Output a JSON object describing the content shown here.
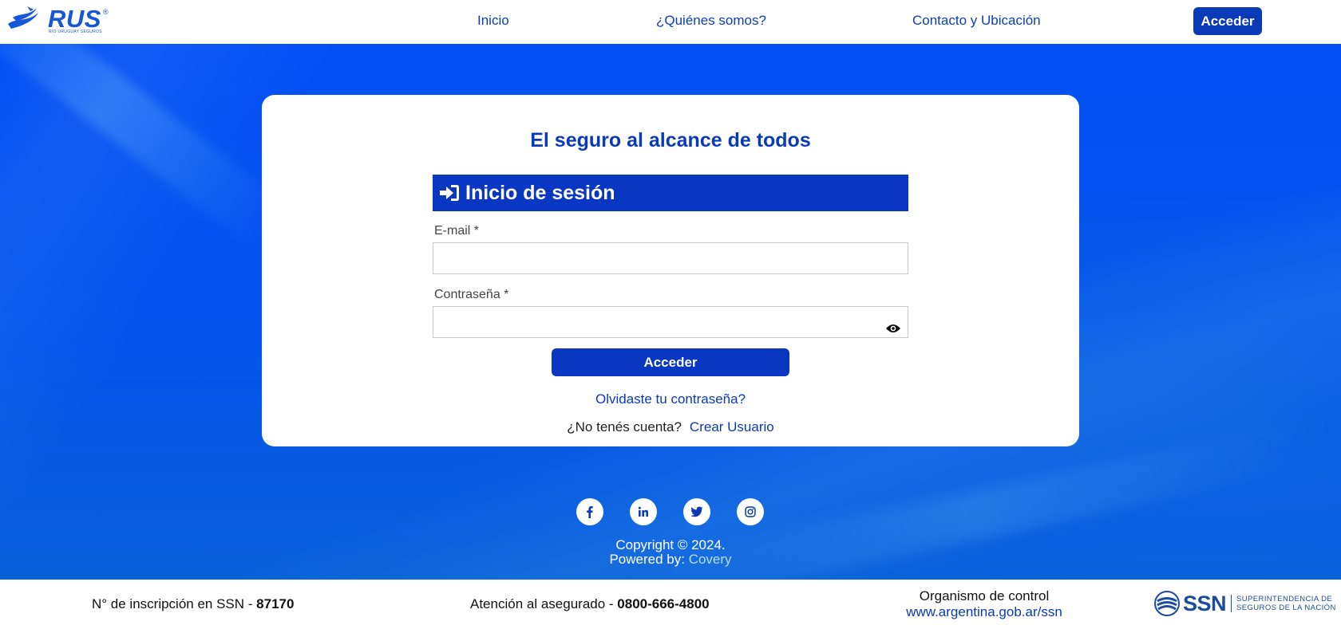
{
  "header": {
    "logo_text": "RUS",
    "logo_reg": "®",
    "logo_sub": "RIO URUGUAY SEGUROS",
    "nav": [
      {
        "label": "Inicio"
      },
      {
        "label": "¿Quiénes somos?"
      },
      {
        "label": "Contacto y Ubicación"
      }
    ],
    "acceder_label": "Acceder"
  },
  "card": {
    "title": "El seguro al alcance de todos",
    "login_title": "Inicio de sesión",
    "email_label": "E-mail *",
    "email_value": "",
    "password_label": "Contraseña *",
    "password_value": "",
    "submit_label": "Acceder",
    "forgot_label": "Olvidaste tu contraseña?",
    "no_account_text": "¿No tenés cuenta?",
    "create_user_label": "Crear Usuario"
  },
  "social": [
    {
      "icon": "facebook-icon"
    },
    {
      "icon": "linkedin-icon"
    },
    {
      "icon": "twitter-icon"
    },
    {
      "icon": "instagram-icon"
    }
  ],
  "copyright": {
    "text": "Copyright © 2024.",
    "powered_prefix": "Powered by:",
    "powered_link": "Covery"
  },
  "footer": {
    "ssn_prefix": "N° de inscripción en SSN -",
    "ssn_number": "87170",
    "attention_prefix": "Atención al asegurado -",
    "attention_phone": "0800-666-4800",
    "control_label": "Organismo de control",
    "control_link": "www.argentina.gob.ar/ssn",
    "ssn_logo_text": "SSN",
    "ssn_logo_line1": "SUPERINTENDENCIA DE",
    "ssn_logo_line2": "SEGUROS DE LA NACIÓN"
  },
  "colors": {
    "brand_blue": "#0a3ab8",
    "hero_blue": "#0450f4",
    "link_light": "#b5dcff"
  }
}
